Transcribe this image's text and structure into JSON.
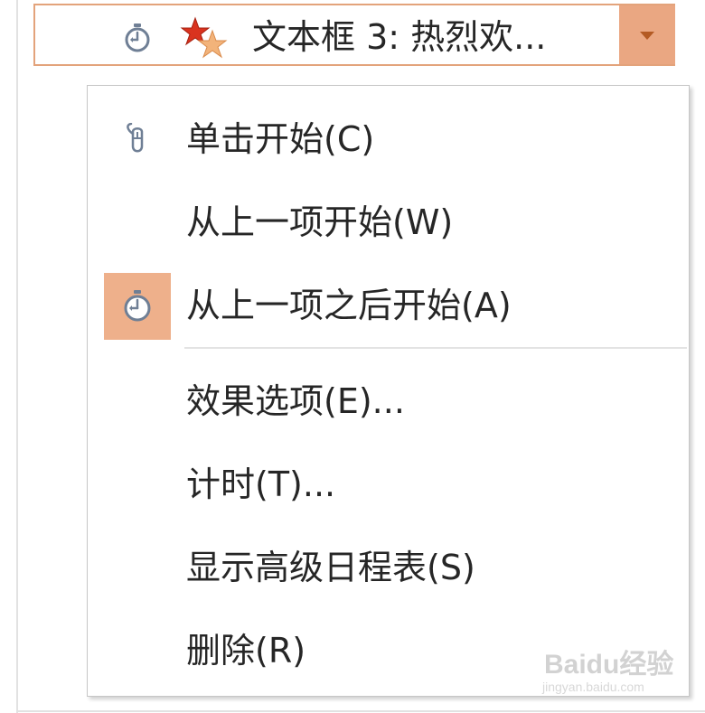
{
  "anim_item": {
    "label": "文本框 3: 热烈欢...",
    "timing_icon": "stopwatch-icon",
    "effect_icon": "emphasis-stars-icon",
    "dropdown_icon": "triangle-down-icon"
  },
  "menu": {
    "items": [
      {
        "label": "单击开始(C)",
        "icon": "mouse-icon",
        "checked": false
      },
      {
        "label": "从上一项开始(W)",
        "icon": "",
        "checked": false
      },
      {
        "label": "从上一项之后开始(A)",
        "icon": "stopwatch-icon",
        "checked": true
      },
      {
        "label": "效果选项(E)...",
        "icon": "",
        "checked": false
      },
      {
        "label": "计时(T)...",
        "icon": "",
        "checked": false
      },
      {
        "label": "显示高级日程表(S)",
        "icon": "",
        "checked": false
      },
      {
        "label": "删除(R)",
        "icon": "",
        "checked": false
      }
    ]
  },
  "watermark": {
    "text": "Baidu经验",
    "url": "jingyan.baidu.com"
  },
  "colors": {
    "accent": "#eaa782",
    "accent_border": "#e3a37b",
    "check_bg": "#eeb08b",
    "text": "#262626"
  }
}
